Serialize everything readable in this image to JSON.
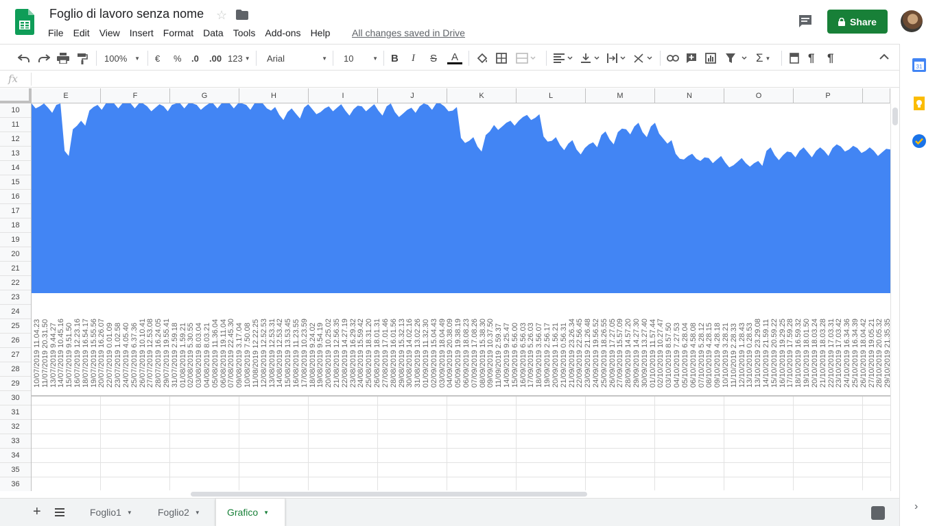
{
  "header": {
    "title": "Foglio di lavoro senza nome",
    "menu": [
      "File",
      "Edit",
      "View",
      "Insert",
      "Format",
      "Data",
      "Tools",
      "Add-ons",
      "Help"
    ],
    "saved_status": "All changes saved in Drive",
    "share_label": "Share"
  },
  "toolbar": {
    "zoom": "100%",
    "currency": "€",
    "percent": "%",
    "decimal_decrease": ".0",
    "decimal_increase": ".00",
    "more_formats": "123",
    "font": "Arial",
    "font_size": "10"
  },
  "formula_bar": {
    "fx_label": "fx"
  },
  "columns": [
    "E",
    "F",
    "G",
    "H",
    "I",
    "J",
    "K",
    "L",
    "M",
    "N",
    "O",
    "P"
  ],
  "rows": [
    "10",
    "11",
    "12",
    "13",
    "14",
    "15",
    "16",
    "17",
    "18",
    "19",
    "20",
    "21",
    "22",
    "23",
    "24",
    "25",
    "26",
    "27",
    "28",
    "29",
    "30",
    "31",
    "32",
    "33",
    "34",
    "35",
    "36"
  ],
  "chart_data": {
    "type": "area",
    "color": "#4285f4",
    "x": [
      "10/07/2019 11.04.23",
      "11/07/2019 20.31.50",
      "13/07/2019 9.44.27",
      "14/07/2019 10.45.16",
      "15/07/2019 9.51.50",
      "16/07/2019 12.23.16",
      "18/07/2019 16.54.17",
      "19/07/2019 15.55.56",
      "20/07/2019 16.26.07",
      "22/07/2019 0.01.09",
      "23/07/2019 1.02.58",
      "24/07/2019 4.05.40",
      "25/07/2019 6.37.36",
      "26/07/2019 10.10.41",
      "27/07/2019 12.53.08",
      "28/07/2019 16.24.05",
      "29/07/2019 19.55.41",
      "31/07/2019 2.59.18",
      "01/08/2019 1.59.21",
      "02/08/2019 5.30.55",
      "03/08/2019 8.03.04",
      "04/08/2019 8.03.21",
      "05/08/2019 11.36.04",
      "06/08/2019 19.11.04",
      "07/08/2019 22.45.30",
      "09/08/2019 3.17.04",
      "10/08/2019 7.50.08",
      "11/08/2019 12.22.25",
      "12/08/2019 12.52.53",
      "13/08/2019 12.53.31",
      "14/08/2019 12.53.42",
      "15/08/2019 13.53.45",
      "16/08/2019 11.23.55",
      "17/08/2019 10.23.59",
      "18/08/2019 9.24.02",
      "19/08/2019 9.54.19",
      "20/08/2019 10.25.02",
      "21/08/2019 12.56.35",
      "22/08/2019 14.27.19",
      "23/08/2019 16.29.32",
      "24/08/2019 15.59.42",
      "25/08/2019 18.31.20",
      "26/08/2019 18.01.31",
      "27/08/2019 17.01.46",
      "28/08/2019 16.01.56",
      "29/08/2019 15.32.13",
      "30/08/2019 14.02.16",
      "31/08/2019 13.02.26",
      "01/09/2019 11.32.30",
      "02/09/2019 15.04.43",
      "03/09/2019 18.04.49",
      "04/09/2019 20.38.09",
      "05/09/2019 19.38.19",
      "06/09/2019 18.08.23",
      "07/09/2019 17.08.26",
      "08/09/2019 15.38.30",
      "09/09/2019 10.37.50",
      "11/09/2019 2.59.37",
      "14/09/2019 9.25.47",
      "15/09/2019 6.56.00",
      "16/09/2019 6.56.03",
      "17/09/2019 5.26.03",
      "18/09/2019 3.56.07",
      "19/09/2019 2.56.17",
      "20/09/2019 1.56.21",
      "21/09/2019 0.56.31",
      "21/09/2019 23.26.34",
      "22/09/2019 22.56.45",
      "23/09/2019 21.26.48",
      "24/09/2019 19.56.52",
      "25/09/2019 18.26.55",
      "26/09/2019 17.27.05",
      "27/09/2019 15.57.09",
      "28/09/2019 14.57.20",
      "29/09/2019 14.27.30",
      "30/09/2019 13.27.40",
      "01/10/2019 11.57.44",
      "02/10/2019 10.27.47",
      "03/10/2019 8.57.50",
      "04/10/2019 7.27.53",
      "05/10/2019 6.28.04",
      "06/10/2019 4.58.08",
      "07/10/2019 5.28.12",
      "08/10/2019 4.28.15",
      "09/10/2019 4.28.18",
      "10/10/2019 3.28.21",
      "11/10/2019 2.28.33",
      "12/10/2019 1.28.43",
      "13/10/2019 0.28.53",
      "13/10/2019 23.29.08",
      "14/10/2019 21.59.11",
      "15/10/2019 20.59.22",
      "16/10/2019 19.29.25",
      "17/10/2019 17.59.28",
      "18/10/2019 16.59.32",
      "19/10/2019 18.01.50",
      "20/10/2019 18.03.24",
      "21/10/2019 18.03.28",
      "22/10/2019 17.03.31",
      "23/10/2019 17.03.42",
      "24/10/2019 16.34.36",
      "25/10/2019 16.34.39",
      "26/10/2019 18.04.42",
      "27/10/2019 19.05.21",
      "28/10/2019 20.05.32",
      "29/10/2019 21.35.35"
    ],
    "values": [
      10.0,
      10.2,
      10.3,
      10.1,
      13.3,
      11.8,
      11.2,
      10.5,
      10.1,
      10.0,
      10.0,
      10.0,
      10.0,
      10.0,
      10.2,
      10.3,
      10.2,
      10.1,
      10.0,
      10.0,
      10.1,
      10.2,
      10.0,
      10.0,
      10.0,
      10.0,
      10.1,
      10.0,
      10.0,
      10.5,
      10.8,
      10.6,
      10.7,
      10.3,
      10.4,
      10.6,
      10.2,
      10.3,
      10.5,
      10.4,
      10.2,
      10.3,
      10.5,
      10.2,
      10.6,
      10.7,
      10.3,
      10.2,
      10.1,
      10.0,
      10.2,
      10.5,
      12.4,
      12.6,
      13.0,
      12.2,
      11.5,
      11.6,
      11.2,
      11.2,
      10.8,
      11.0,
      12.3,
      12.6,
      12.9,
      12.8,
      13.2,
      13.1,
      12.7,
      12.2,
      12.5,
      12.0,
      11.8,
      11.6,
      12.0,
      11.6,
      12.1,
      12.8,
      13.5,
      13.9,
      13.5,
      14.0,
      13.8,
      13.9,
      14.1,
      14.3,
      13.8,
      14.4,
      14.0,
      13.3,
      13.6,
      13.6,
      13.4,
      13.3,
      13.4,
      13.3,
      13.3,
      13.1,
      13.0,
      13.2,
      13.1,
      13.3,
      13.3,
      13.4,
      13.2
    ]
  },
  "sheets": [
    {
      "name": "Foglio1",
      "active": false
    },
    {
      "name": "Foglio2",
      "active": false
    },
    {
      "name": "Grafico",
      "active": true
    }
  ],
  "colors": {
    "accent": "#188038",
    "chart_fill": "#4285f4"
  }
}
